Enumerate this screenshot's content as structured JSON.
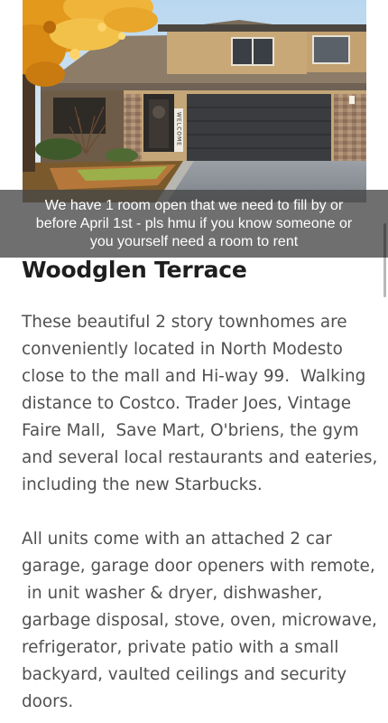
{
  "photo": {
    "door_sign_text": "WELCOME"
  },
  "caption": {
    "lines": [
      "We have 1 room open that we need to fill by or",
      "before April 1st - pls hmu if you know someone or",
      "you yourself need a room to rent"
    ]
  },
  "listing": {
    "title": "Woodglen Terrace",
    "paragraphs": [
      {
        "lines": [
          "These beautiful 2 story townhomes are",
          "conveniently located in North Modesto",
          "close to the mall and Hi-way 99.  Walking",
          "distance to Costco. Trader Joes, Vintage",
          "Faire Mall,  Save Mart, O'briens, the gym",
          "and several local restaurants and eateries,",
          "including the new Starbucks."
        ]
      },
      {
        "lines": [
          "All units come with an attached 2 car",
          "garage, garage door openers with remote,",
          " in unit washer & dryer, dishwasher,",
          "garbage disposal, stove, oven, microwave,",
          "refrigerator, private patio with a small",
          "backyard, vaulted ceilings and security",
          "doors."
        ]
      }
    ]
  },
  "colors": {
    "caption_bg": "#464646",
    "title_text": "#1e1e1e",
    "body_text": "#505050",
    "garage_door": "#3a3c3f",
    "siding": "#c9a878",
    "roof": "#8a7a66",
    "sky": "#cfe3f2",
    "foliage": "#e39a1c"
  }
}
